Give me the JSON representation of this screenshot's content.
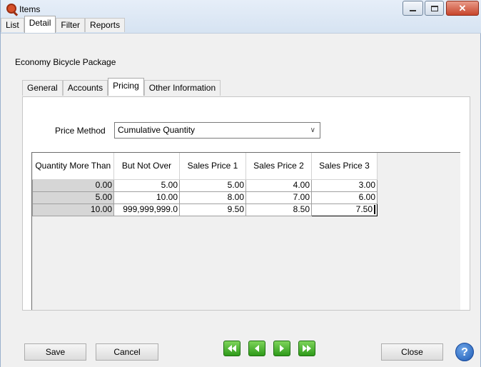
{
  "window": {
    "title": "Items"
  },
  "top_tabs": [
    {
      "label": "List"
    },
    {
      "label": "Detail",
      "active": true
    },
    {
      "label": "Filter"
    },
    {
      "label": "Reports"
    }
  ],
  "record_title": "Economy Bicycle Package",
  "sub_tabs": [
    {
      "label": "General"
    },
    {
      "label": "Accounts"
    },
    {
      "label": "Pricing",
      "active": true
    },
    {
      "label": "Other Information"
    }
  ],
  "price_method": {
    "label": "Price Method",
    "value": "Cumulative Quantity"
  },
  "grid": {
    "columns": [
      "Quantity More Than",
      "But Not Over",
      "Sales Price 1",
      "Sales Price 2",
      "Sales Price 3"
    ],
    "rows": [
      [
        "0.00",
        "5.00",
        "5.00",
        "4.00",
        "3.00"
      ],
      [
        "5.00",
        "10.00",
        "8.00",
        "7.00",
        "6.00"
      ],
      [
        "10.00",
        "999,999,999.0",
        "9.50",
        "8.50",
        "7.50"
      ]
    ]
  },
  "buttons": {
    "save": "Save",
    "cancel": "Cancel",
    "close": "Close",
    "help": "?"
  },
  "nav_icons": [
    "first-record-icon",
    "previous-record-icon",
    "next-record-icon",
    "last-record-icon"
  ],
  "colors": {
    "nav_green": "#2e9a1a",
    "close_red": "#c7452c",
    "help_blue": "#1d5bb5"
  }
}
